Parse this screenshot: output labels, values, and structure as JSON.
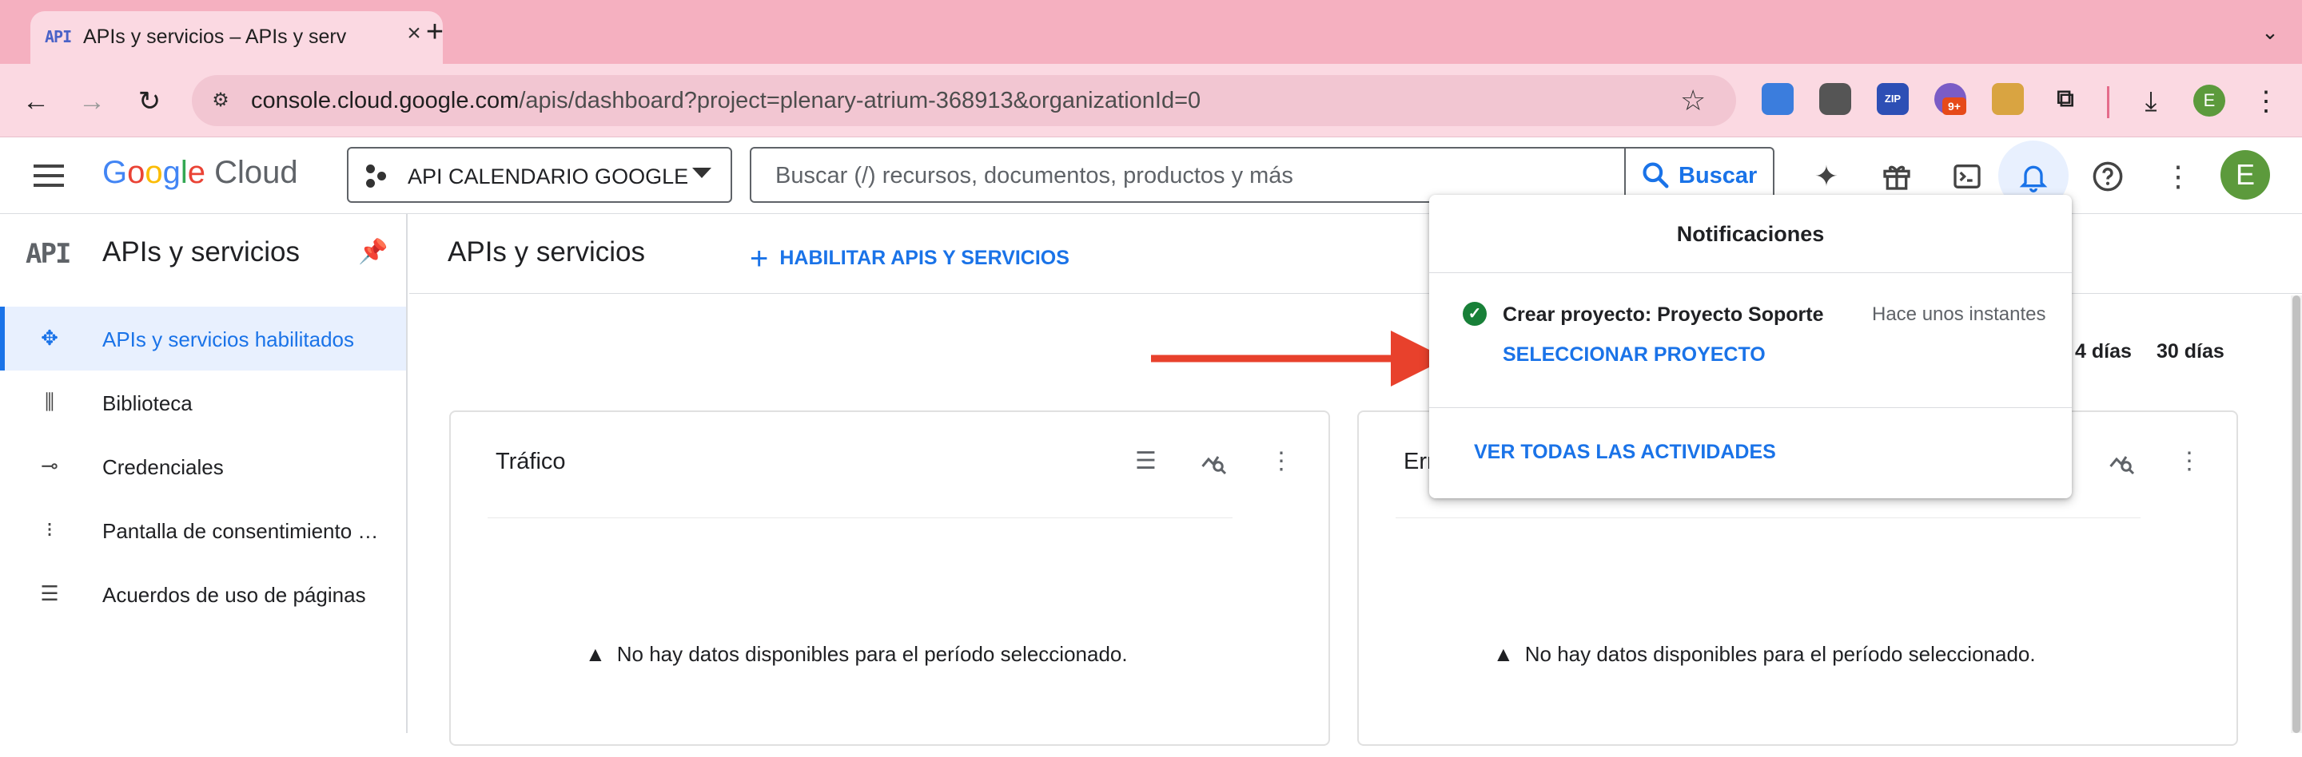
{
  "browser": {
    "tab": {
      "favicon_text": "API",
      "title": "APIs y servicios – APIs y serv",
      "close_icon": "×"
    },
    "new_tab_icon": "+",
    "tab_menu_icon": "⌄",
    "back_icon": "←",
    "forward_icon": "→",
    "reload_icon": "↻",
    "url_host": "console.cloud.google.com",
    "url_rest": "/apis/dashboard?project=plenary-atrium-368913&organizationId=0",
    "bookmark_icon": "☆",
    "extensions": {
      "zip_label": "ZIP",
      "badge": "9+"
    },
    "profile_initial": "E",
    "menu_icon": "⋮"
  },
  "header": {
    "logo": {
      "g1": "G",
      "g2": "o",
      "g3": "o",
      "g4": "g",
      "g5": "l",
      "g6": "e",
      "cloud": " Cloud"
    },
    "project_name": "API CALENDARIO GOOGLE",
    "search_placeholder": "Buscar (/) recursos, documentos, productos y más",
    "search_button": "Buscar",
    "avatar_initial": "E"
  },
  "sidebar": {
    "logo_text": "API",
    "title": "APIs y servicios",
    "items": [
      {
        "label": "APIs y servicios habilitados",
        "icon": "apis-icon",
        "active": true
      },
      {
        "label": "Biblioteca",
        "icon": "library-icon",
        "active": false
      },
      {
        "label": "Credenciales",
        "icon": "key-icon",
        "active": false
      },
      {
        "label": "Pantalla de consentimiento …",
        "icon": "consent-icon",
        "active": false
      },
      {
        "label": "Acuerdos de uso de páginas",
        "icon": "settings-list-icon",
        "active": false
      }
    ]
  },
  "main": {
    "title": "APIs y servicios",
    "enable_button": "HABILITAR APIS Y SERVICIOS",
    "periods": [
      "4 días",
      "30 días"
    ],
    "cards": [
      {
        "title": "Tráfico",
        "no_data": "No hay datos disponibles para el período seleccionado."
      },
      {
        "title": "Err",
        "no_data": "No hay datos disponibles para el período seleccionado."
      }
    ]
  },
  "notifications": {
    "title": "Notificaciones",
    "item_message": "Crear proyecto: Proyecto Soporte",
    "item_time": "Hace unos instantes",
    "item_action": "SELECCIONAR PROYECTO",
    "view_all": "VER TODAS LAS ACTIVIDADES"
  },
  "colors": {
    "accent": "#1a73e8",
    "tab_strip": "#f5b0c0",
    "annotation_arrow": "#e8412c",
    "success": "#188038"
  }
}
